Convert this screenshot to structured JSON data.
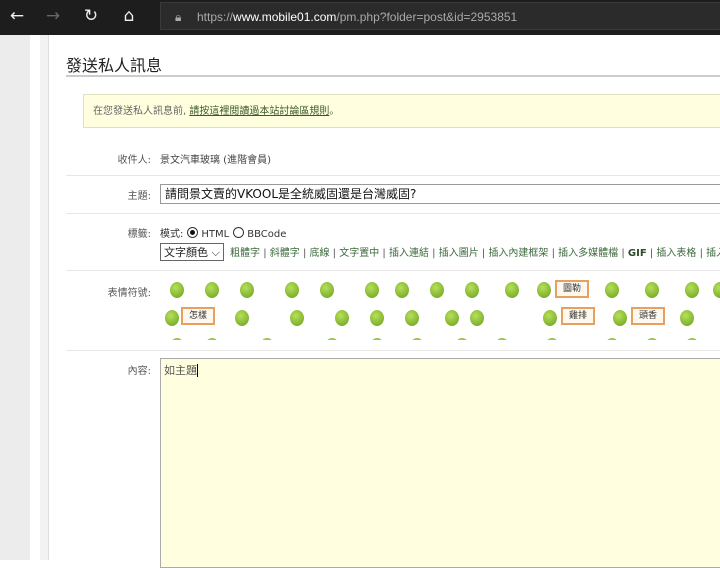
{
  "browser": {
    "url_prefix": "https://",
    "url_domain": "www.mobile01.com",
    "url_path": "/pm.php?folder=post&id=2953851"
  },
  "page": {
    "title": "發送私人訊息",
    "notice_text": "在您發送私人訊息前, ",
    "notice_link": "請按這裡閱讀過本站討論區規則",
    "notice_end": "。",
    "recipient_label": "收件人:",
    "recipient": "景文汽車玻璃 (進階會員)",
    "subject_label": "主題:",
    "subject": "請問景文賣的VKOOL是全統威固還是台灣威固?",
    "tags_label": "標籤:",
    "mode_label": "模式:",
    "mode_html": "HTML",
    "mode_bbcode": "BBCode",
    "color_select": "文字顏色",
    "tools": [
      "粗體字",
      "斜體字",
      "底線",
      "文字置中",
      "插入連結",
      "插入圖片",
      "插入內建框架",
      "插入多媒體檔",
      "GIF",
      "插入表格",
      "插入"
    ],
    "emoticons_label": "表情符號:",
    "emoticon_tags": [
      "圖勒",
      "怎樣",
      "雞排",
      "頭香"
    ],
    "content_label": "內容:",
    "content": "如主題"
  }
}
